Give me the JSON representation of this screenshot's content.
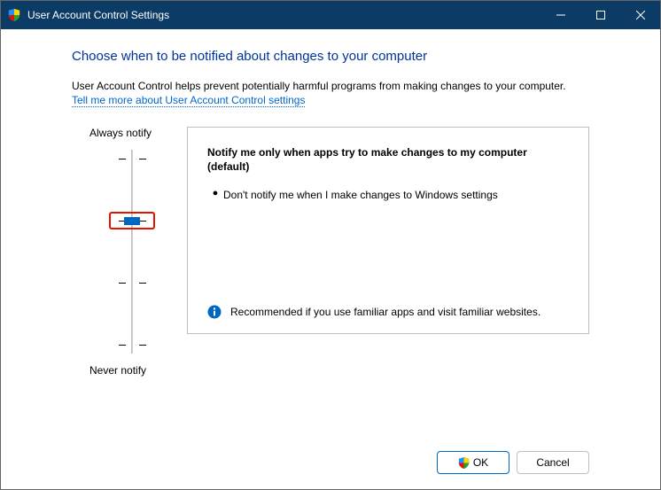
{
  "titlebar": {
    "title": "User Account Control Settings"
  },
  "heading": "Choose when to be notified about changes to your computer",
  "desc": "User Account Control helps prevent potentially harmful programs from making changes to your computer.",
  "link": "Tell me more about User Account Control settings",
  "slider": {
    "top_label": "Always notify",
    "bottom_label": "Never notify",
    "levels": 4,
    "current_index": 1
  },
  "panel": {
    "title": "Notify me only when apps try to make changes to my computer (default)",
    "bullet": "Don't notify me when I make changes to Windows settings",
    "recommend": "Recommended if you use familiar apps and visit familiar websites."
  },
  "buttons": {
    "ok": "OK",
    "cancel": "Cancel"
  }
}
